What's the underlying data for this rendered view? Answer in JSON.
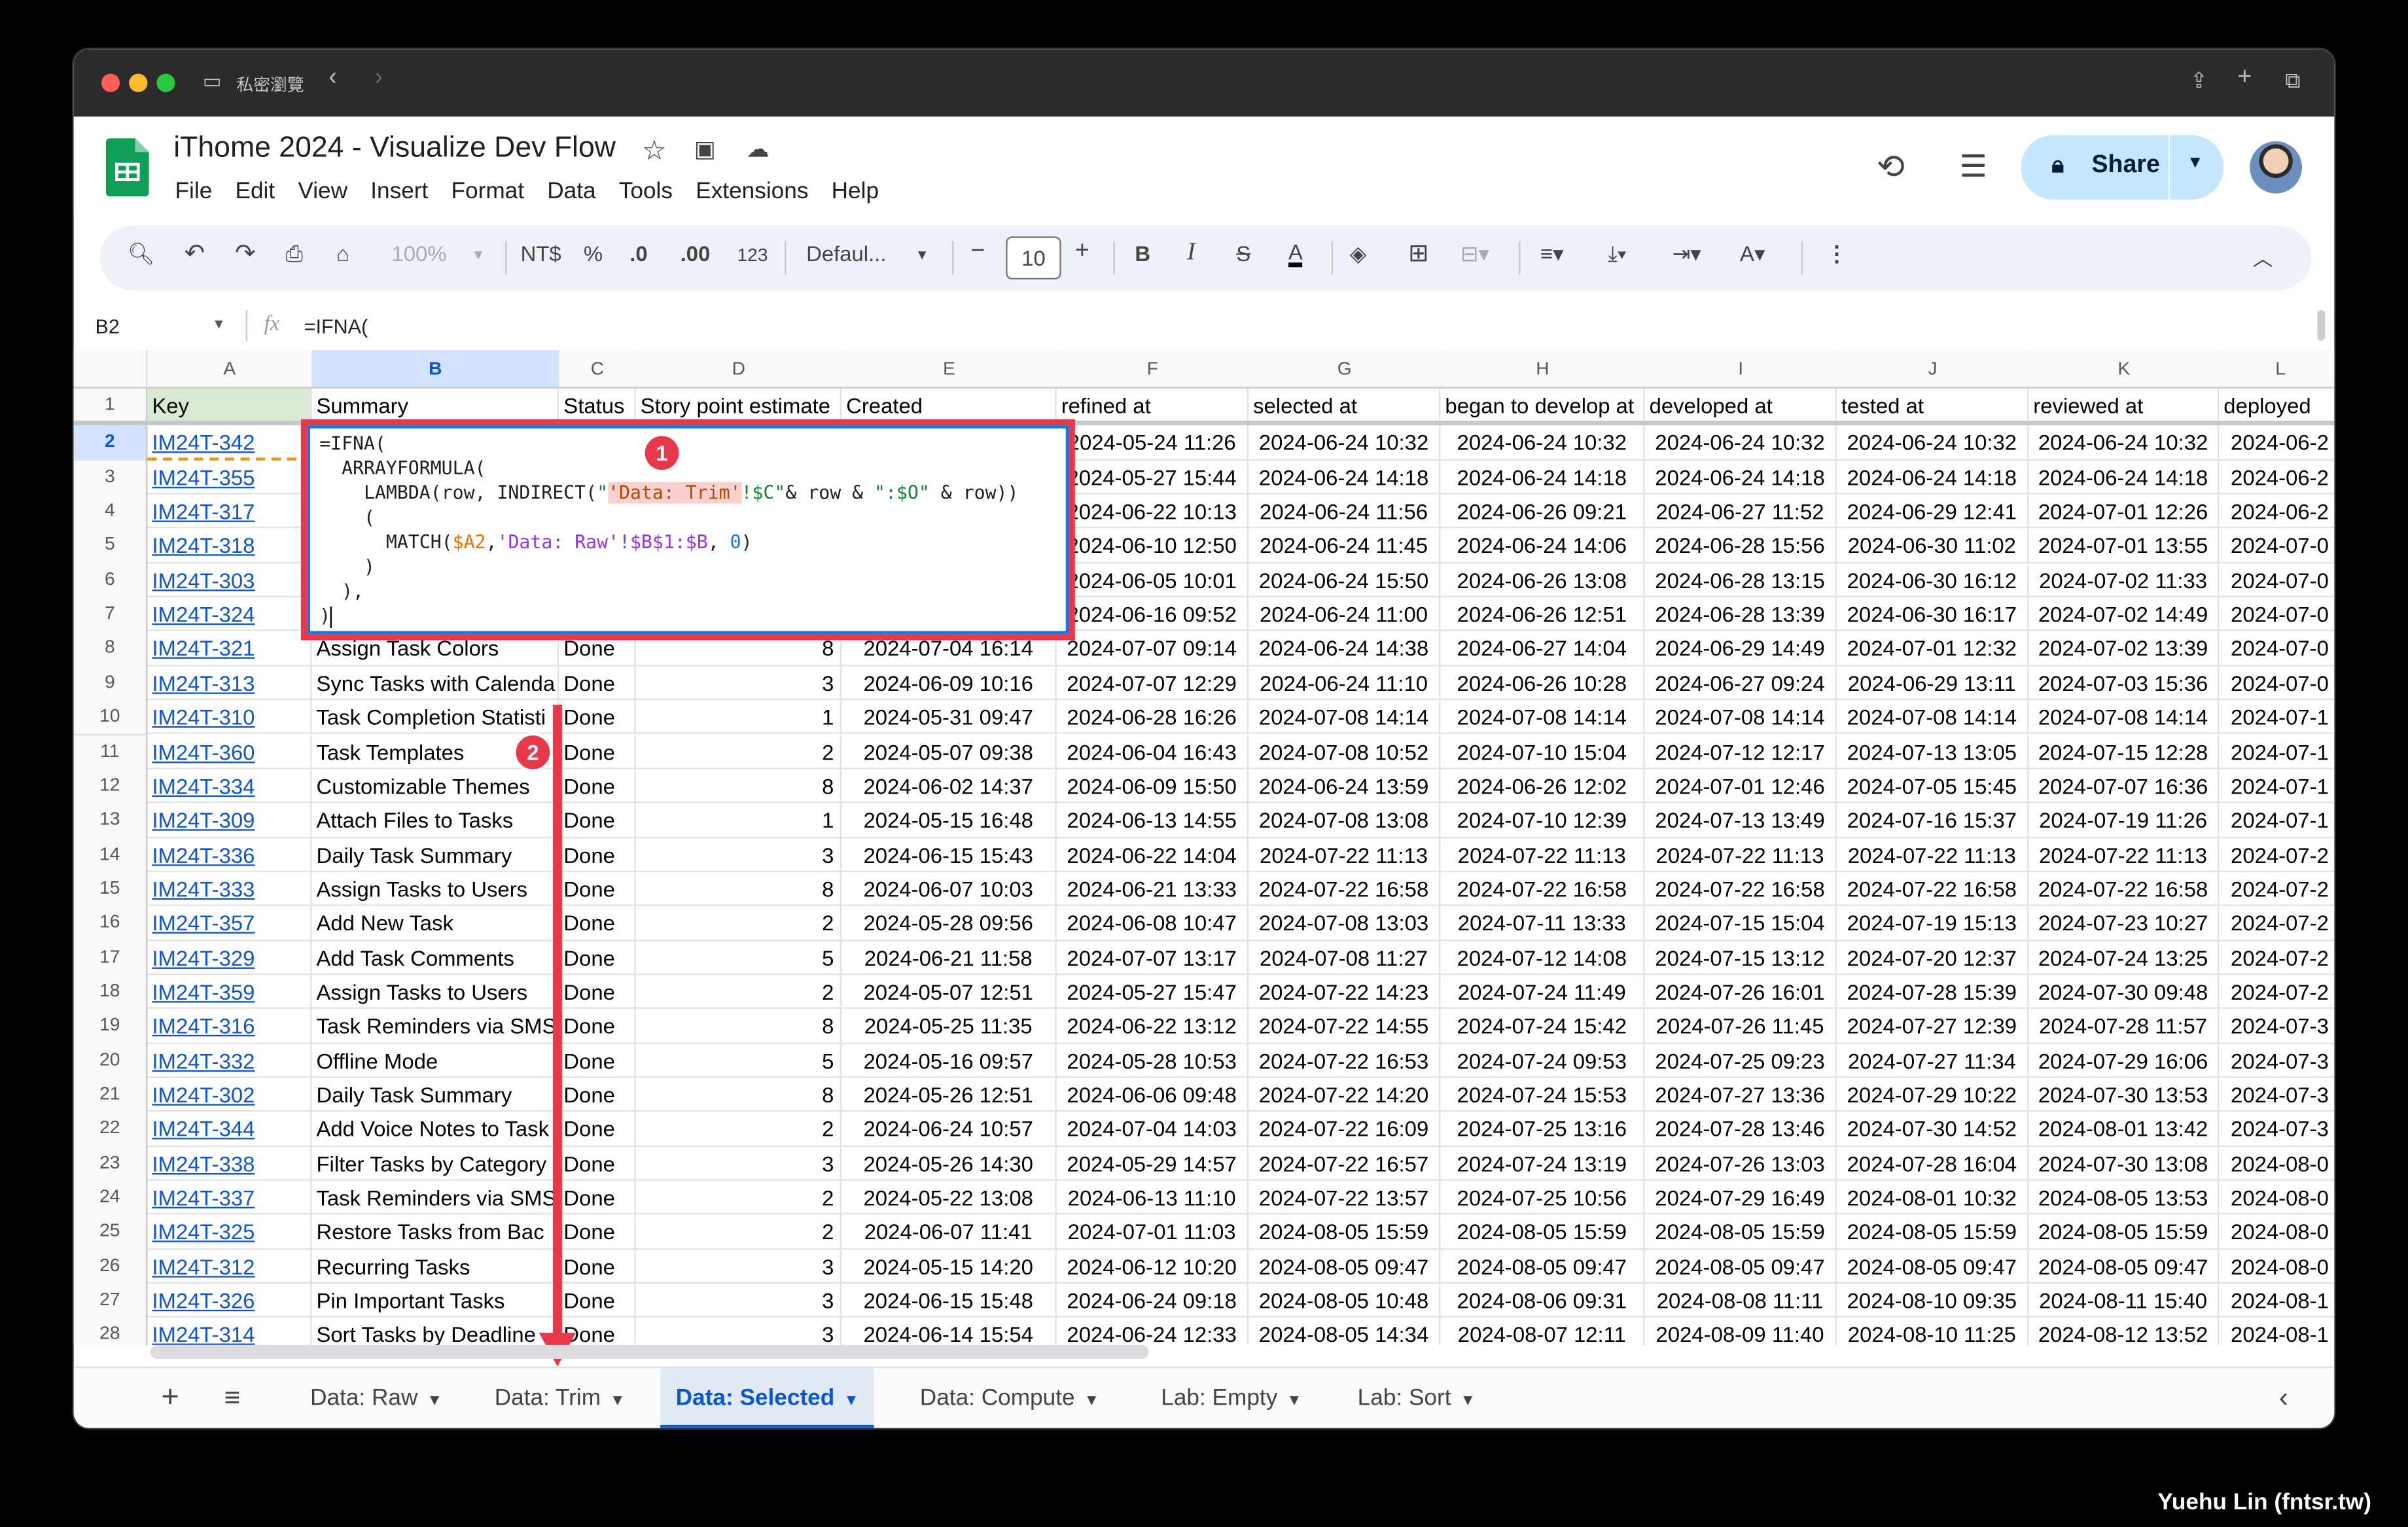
{
  "browser": {
    "private_label": "私密瀏覽"
  },
  "app": {
    "title": "iThome 2024 - Visualize Dev Flow",
    "menu": [
      "File",
      "Edit",
      "View",
      "Insert",
      "Format",
      "Data",
      "Tools",
      "Extensions",
      "Help"
    ],
    "share_label": "Share"
  },
  "toolbar": {
    "zoom": "100%",
    "currency": "NT$",
    "percent": "%",
    "dec_decrease": ".0",
    "dec_increase": ".00",
    "number_format": "123",
    "font": "Defaul...",
    "font_size": "10"
  },
  "formula_bar": {
    "cell_ref": "B2",
    "fx": "fx",
    "content": "=IFNA("
  },
  "columns": [
    {
      "letter": "A",
      "header": "Key"
    },
    {
      "letter": "B",
      "header": "Summary"
    },
    {
      "letter": "C",
      "header": "Status"
    },
    {
      "letter": "D",
      "header": "Story point estimate"
    },
    {
      "letter": "E",
      "header": "Created"
    },
    {
      "letter": "F",
      "header": "refined at"
    },
    {
      "letter": "G",
      "header": "selected at"
    },
    {
      "letter": "H",
      "header": "began to develop at"
    },
    {
      "letter": "I",
      "header": "developed at"
    },
    {
      "letter": "J",
      "header": "tested at"
    },
    {
      "letter": "K",
      "header": "reviewed at"
    },
    {
      "letter": "L",
      "header": "deployed"
    }
  ],
  "rows": [
    {
      "n": "2",
      "key": "IM24T-342",
      "summary": "",
      "status": "",
      "sp": "",
      "created": "",
      "f": "2024-05-24 11:26",
      "g": "2024-06-24 10:32",
      "h": "2024-06-24 10:32",
      "i": "2024-06-24 10:32",
      "j": "2024-06-24 10:32",
      "k": "2024-06-24 10:32",
      "l": "2024-06-2"
    },
    {
      "n": "3",
      "key": "IM24T-355",
      "summary": "",
      "status": "",
      "sp": "",
      "created": "",
      "f": "2024-05-27 15:44",
      "g": "2024-06-24 14:18",
      "h": "2024-06-24 14:18",
      "i": "2024-06-24 14:18",
      "j": "2024-06-24 14:18",
      "k": "2024-06-24 14:18",
      "l": "2024-06-2"
    },
    {
      "n": "4",
      "key": "IM24T-317",
      "summary": "",
      "status": "",
      "sp": "",
      "created": "",
      "f": "2024-06-22 10:13",
      "g": "2024-06-24 11:56",
      "h": "2024-06-26 09:21",
      "i": "2024-06-27 11:52",
      "j": "2024-06-29 12:41",
      "k": "2024-07-01 12:26",
      "l": "2024-06-2"
    },
    {
      "n": "5",
      "key": "IM24T-318",
      "summary": "",
      "status": "",
      "sp": "",
      "created": "",
      "f": "2024-06-10 12:50",
      "g": "2024-06-24 11:45",
      "h": "2024-06-24 14:06",
      "i": "2024-06-28 15:56",
      "j": "2024-06-30 11:02",
      "k": "2024-07-01 13:55",
      "l": "2024-07-0"
    },
    {
      "n": "6",
      "key": "IM24T-303",
      "summary": "",
      "status": "",
      "sp": "",
      "created": "",
      "f": "2024-06-05 10:01",
      "g": "2024-06-24 15:50",
      "h": "2024-06-26 13:08",
      "i": "2024-06-28 13:15",
      "j": "2024-06-30 16:12",
      "k": "2024-07-02 11:33",
      "l": "2024-07-0"
    },
    {
      "n": "7",
      "key": "IM24T-324",
      "summary": "",
      "status": "",
      "sp": "",
      "created": "",
      "f": "2024-06-16 09:52",
      "g": "2024-06-24 11:00",
      "h": "2024-06-26 12:51",
      "i": "2024-06-28 13:39",
      "j": "2024-06-30 16:17",
      "k": "2024-07-02 14:49",
      "l": "2024-07-0"
    },
    {
      "n": "8",
      "key": "IM24T-321",
      "summary": "Assign Task Colors",
      "status": "Done",
      "sp": "8",
      "created": "2024-07-04 16:14",
      "f": "2024-07-07 09:14",
      "g": "2024-06-24 14:38",
      "h": "2024-06-27 14:04",
      "i": "2024-06-29 14:49",
      "j": "2024-07-01 12:32",
      "k": "2024-07-02 13:39",
      "l": "2024-07-0"
    },
    {
      "n": "9",
      "key": "IM24T-313",
      "summary": "Sync Tasks with Calenda",
      "status": "Done",
      "sp": "3",
      "created": "2024-06-09 10:16",
      "f": "2024-07-07 12:29",
      "g": "2024-06-24 11:10",
      "h": "2024-06-26 10:28",
      "i": "2024-06-27 09:24",
      "j": "2024-06-29 13:11",
      "k": "2024-07-03 15:36",
      "l": "2024-07-0"
    },
    {
      "n": "10",
      "key": "IM24T-310",
      "summary": "Task Completion Statisti",
      "status": "Done",
      "sp": "1",
      "created": "2024-05-31 09:47",
      "f": "2024-06-28 16:26",
      "g": "2024-07-08 14:14",
      "h": "2024-07-08 14:14",
      "i": "2024-07-08 14:14",
      "j": "2024-07-08 14:14",
      "k": "2024-07-08 14:14",
      "l": "2024-07-1"
    },
    {
      "n": "11",
      "key": "IM24T-360",
      "summary": "Task Templates",
      "status": "Done",
      "sp": "2",
      "created": "2024-05-07 09:38",
      "f": "2024-06-04 16:43",
      "g": "2024-07-08 10:52",
      "h": "2024-07-10 15:04",
      "i": "2024-07-12 12:17",
      "j": "2024-07-13 13:05",
      "k": "2024-07-15 12:28",
      "l": "2024-07-1"
    },
    {
      "n": "12",
      "key": "IM24T-334",
      "summary": "Customizable Themes",
      "status": "Done",
      "sp": "8",
      "created": "2024-06-02 14:37",
      "f": "2024-06-09 15:50",
      "g": "2024-06-24 13:59",
      "h": "2024-06-26 12:02",
      "i": "2024-07-01 12:46",
      "j": "2024-07-05 15:45",
      "k": "2024-07-07 16:36",
      "l": "2024-07-1"
    },
    {
      "n": "13",
      "key": "IM24T-309",
      "summary": "Attach Files to Tasks",
      "status": "Done",
      "sp": "1",
      "created": "2024-05-15 16:48",
      "f": "2024-06-13 14:55",
      "g": "2024-07-08 13:08",
      "h": "2024-07-10 12:39",
      "i": "2024-07-13 13:49",
      "j": "2024-07-16 15:37",
      "k": "2024-07-19 11:26",
      "l": "2024-07-1"
    },
    {
      "n": "14",
      "key": "IM24T-336",
      "summary": "Daily Task Summary",
      "status": "Done",
      "sp": "3",
      "created": "2024-06-15 15:43",
      "f": "2024-06-22 14:04",
      "g": "2024-07-22 11:13",
      "h": "2024-07-22 11:13",
      "i": "2024-07-22 11:13",
      "j": "2024-07-22 11:13",
      "k": "2024-07-22 11:13",
      "l": "2024-07-2"
    },
    {
      "n": "15",
      "key": "IM24T-333",
      "summary": "Assign Tasks to Users",
      "status": "Done",
      "sp": "8",
      "created": "2024-06-07 10:03",
      "f": "2024-06-21 13:33",
      "g": "2024-07-22 16:58",
      "h": "2024-07-22 16:58",
      "i": "2024-07-22 16:58",
      "j": "2024-07-22 16:58",
      "k": "2024-07-22 16:58",
      "l": "2024-07-2"
    },
    {
      "n": "16",
      "key": "IM24T-357",
      "summary": "Add New Task",
      "status": "Done",
      "sp": "2",
      "created": "2024-05-28 09:56",
      "f": "2024-06-08 10:47",
      "g": "2024-07-08 13:03",
      "h": "2024-07-11 13:33",
      "i": "2024-07-15 15:04",
      "j": "2024-07-19 15:13",
      "k": "2024-07-23 10:27",
      "l": "2024-07-2"
    },
    {
      "n": "17",
      "key": "IM24T-329",
      "summary": "Add Task Comments",
      "status": "Done",
      "sp": "5",
      "created": "2024-06-21 11:58",
      "f": "2024-07-07 13:17",
      "g": "2024-07-08 11:27",
      "h": "2024-07-12 14:08",
      "i": "2024-07-15 13:12",
      "j": "2024-07-20 12:37",
      "k": "2024-07-24 13:25",
      "l": "2024-07-2"
    },
    {
      "n": "18",
      "key": "IM24T-359",
      "summary": "Assign Tasks to Users",
      "status": "Done",
      "sp": "2",
      "created": "2024-05-07 12:51",
      "f": "2024-05-27 15:47",
      "g": "2024-07-22 14:23",
      "h": "2024-07-24 11:49",
      "i": "2024-07-26 16:01",
      "j": "2024-07-28 15:39",
      "k": "2024-07-30 09:48",
      "l": "2024-07-2"
    },
    {
      "n": "19",
      "key": "IM24T-316",
      "summary": "Task Reminders via SMS",
      "status": "Done",
      "sp": "8",
      "created": "2024-05-25 11:35",
      "f": "2024-06-22 13:12",
      "g": "2024-07-22 14:55",
      "h": "2024-07-24 15:42",
      "i": "2024-07-26 11:45",
      "j": "2024-07-27 12:39",
      "k": "2024-07-28 11:57",
      "l": "2024-07-3"
    },
    {
      "n": "20",
      "key": "IM24T-332",
      "summary": "Offline Mode",
      "status": "Done",
      "sp": "5",
      "created": "2024-05-16 09:57",
      "f": "2024-05-28 10:53",
      "g": "2024-07-22 16:53",
      "h": "2024-07-24 09:53",
      "i": "2024-07-25 09:23",
      "j": "2024-07-27 11:34",
      "k": "2024-07-29 16:06",
      "l": "2024-07-3"
    },
    {
      "n": "21",
      "key": "IM24T-302",
      "summary": "Daily Task Summary",
      "status": "Done",
      "sp": "8",
      "created": "2024-05-26 12:51",
      "f": "2024-06-06 09:48",
      "g": "2024-07-22 14:20",
      "h": "2024-07-24 15:53",
      "i": "2024-07-27 13:36",
      "j": "2024-07-29 10:22",
      "k": "2024-07-30 13:53",
      "l": "2024-07-3"
    },
    {
      "n": "22",
      "key": "IM24T-344",
      "summary": "Add Voice Notes to Task",
      "status": "Done",
      "sp": "2",
      "created": "2024-06-24 10:57",
      "f": "2024-07-04 14:03",
      "g": "2024-07-22 16:09",
      "h": "2024-07-25 13:16",
      "i": "2024-07-28 13:46",
      "j": "2024-07-30 14:52",
      "k": "2024-08-01 13:42",
      "l": "2024-07-3"
    },
    {
      "n": "23",
      "key": "IM24T-338",
      "summary": "Filter Tasks by Category",
      "status": "Done",
      "sp": "3",
      "created": "2024-05-26 14:30",
      "f": "2024-05-29 14:57",
      "g": "2024-07-22 16:57",
      "h": "2024-07-24 13:19",
      "i": "2024-07-26 13:03",
      "j": "2024-07-28 16:04",
      "k": "2024-07-30 13:08",
      "l": "2024-08-0"
    },
    {
      "n": "24",
      "key": "IM24T-337",
      "summary": "Task Reminders via SMS",
      "status": "Done",
      "sp": "2",
      "created": "2024-05-22 13:08",
      "f": "2024-06-13 11:10",
      "g": "2024-07-22 13:57",
      "h": "2024-07-25 10:56",
      "i": "2024-07-29 16:49",
      "j": "2024-08-01 10:32",
      "k": "2024-08-05 13:53",
      "l": "2024-08-0"
    },
    {
      "n": "25",
      "key": "IM24T-325",
      "summary": "Restore Tasks from Bac",
      "status": "Done",
      "sp": "2",
      "created": "2024-06-07 11:41",
      "f": "2024-07-01 11:03",
      "g": "2024-08-05 15:59",
      "h": "2024-08-05 15:59",
      "i": "2024-08-05 15:59",
      "j": "2024-08-05 15:59",
      "k": "2024-08-05 15:59",
      "l": "2024-08-0"
    },
    {
      "n": "26",
      "key": "IM24T-312",
      "summary": "Recurring Tasks",
      "status": "Done",
      "sp": "3",
      "created": "2024-05-15 14:20",
      "f": "2024-06-12 10:20",
      "g": "2024-08-05 09:47",
      "h": "2024-08-05 09:47",
      "i": "2024-08-05 09:47",
      "j": "2024-08-05 09:47",
      "k": "2024-08-05 09:47",
      "l": "2024-08-0"
    },
    {
      "n": "27",
      "key": "IM24T-326",
      "summary": "Pin Important Tasks",
      "status": "Done",
      "sp": "3",
      "created": "2024-06-15 15:48",
      "f": "2024-06-24 09:18",
      "g": "2024-08-05 10:48",
      "h": "2024-08-06 09:31",
      "i": "2024-08-08 11:11",
      "j": "2024-08-10 09:35",
      "k": "2024-08-11 15:40",
      "l": "2024-08-1"
    },
    {
      "n": "28",
      "key": "IM24T-314",
      "summary": "Sort Tasks by Deadline",
      "status": "Done",
      "sp": "3",
      "created": "2024-06-14 15:54",
      "f": "2024-06-24 12:33",
      "g": "2024-08-05 14:34",
      "h": "2024-08-07 12:11",
      "i": "2024-08-09 11:40",
      "j": "2024-08-10 11:25",
      "k": "2024-08-12 13:52",
      "l": "2024-08-1"
    }
  ],
  "formula_lines": [
    "=IFNA(",
    "  ARRAYFORMULA(",
    "    LAMBDA(row, INDIRECT(\"'Data: Trim'!$C\"& row & \":$O\" & row))",
    "    (",
    "      MATCH($A2,'Data: Raw'!$B$1:$B, 0)",
    "    )",
    "  ),",
    ")"
  ],
  "annotations": {
    "badge1": "1",
    "badge2": "2"
  },
  "sheet_tabs": [
    "Data: Raw",
    "Data: Trim",
    "Data: Selected",
    "Data: Compute",
    "Lab: Empty",
    "Lab: Sort"
  ],
  "active_tab": "Data: Selected",
  "watermark": "Yuehu Lin (fntsr.tw)",
  "colors": {
    "annotation": "#e8394a",
    "selection": "#1a73e8",
    "share_bg": "#c2e7ff"
  }
}
